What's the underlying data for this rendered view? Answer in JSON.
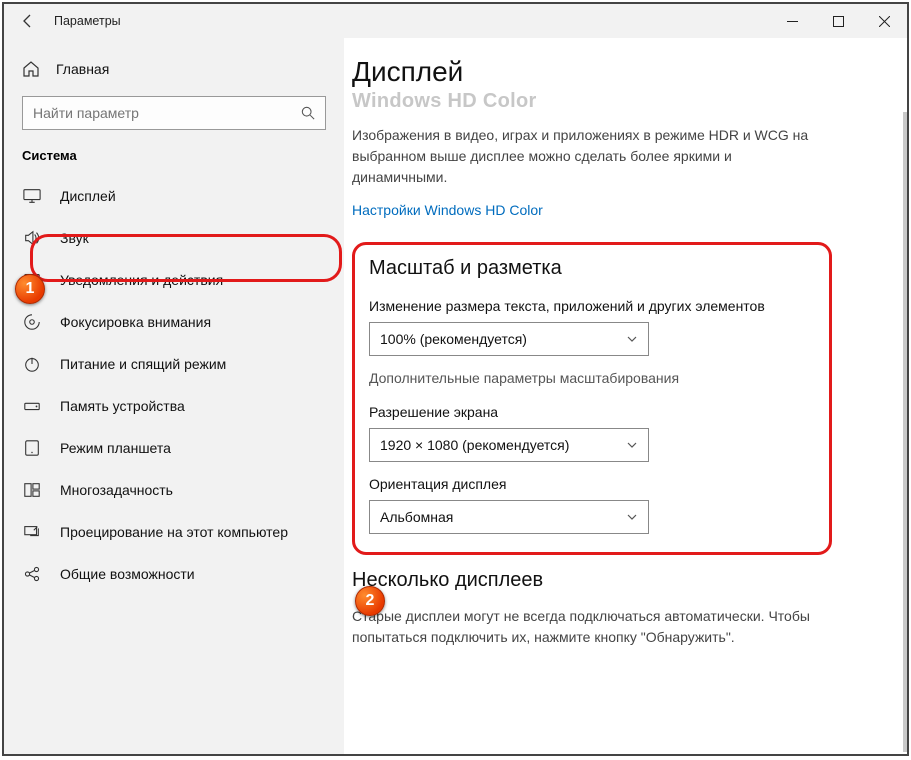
{
  "window": {
    "title": "Параметры"
  },
  "sidebar": {
    "home": "Главная",
    "search_placeholder": "Найти параметр",
    "section": "Система",
    "items": [
      {
        "label": "Дисплей"
      },
      {
        "label": "Звук"
      },
      {
        "label": "Уведомления и действия"
      },
      {
        "label": "Фокусировка внимания"
      },
      {
        "label": "Питание и спящий режим"
      },
      {
        "label": "Память устройства"
      },
      {
        "label": "Режим планшета"
      },
      {
        "label": "Многозадачность"
      },
      {
        "label": "Проецирование на этот компьютер"
      },
      {
        "label": "Общие возможности"
      }
    ]
  },
  "content": {
    "title": "Дисплей",
    "hdcolor_heading": "Windows HD Color",
    "hdcolor_desc": "Изображения в видео, играх и приложениях в режиме HDR и WCG на выбранном выше дисплее можно сделать более яркими и динамичными.",
    "hdcolor_link": "Настройки Windows HD Color",
    "scale": {
      "heading": "Масштаб и разметка",
      "size_label": "Изменение размера текста, приложений и других элементов",
      "size_value": "100% (рекомендуется)",
      "advanced": "Дополнительные параметры масштабирования",
      "res_label": "Разрешение экрана",
      "res_value": "1920 × 1080 (рекомендуется)",
      "orient_label": "Ориентация дисплея",
      "orient_value": "Альбомная"
    },
    "multi": {
      "heading": "Несколько дисплеев",
      "desc": "Старые дисплеи могут не всегда подключаться автоматически. Чтобы попытаться подключить их, нажмите кнопку \"Обнаружить\"."
    }
  },
  "badges": {
    "one": "1",
    "two": "2"
  }
}
